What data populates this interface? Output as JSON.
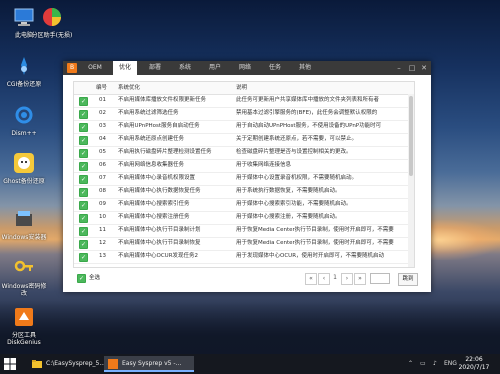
{
  "desktop_icons": [
    {
      "label": "此电脑"
    },
    {
      "label": "分区助手(无损)"
    },
    {
      "label": "CGI备份还原"
    },
    {
      "label": "Dism++"
    },
    {
      "label": "Ghost备份还原"
    },
    {
      "label": "Windows安装器"
    },
    {
      "label": "Windows密码修改"
    },
    {
      "label": "分区工具DiskGenius"
    }
  ],
  "window": {
    "logo": "B",
    "tabs": [
      "OEM",
      "优化",
      "部署",
      "系统",
      "用户",
      "网络",
      "任务",
      "其他"
    ],
    "active_tab": "优化",
    "controls": {
      "min": "–",
      "max": "□",
      "close": "✕"
    },
    "table": {
      "headers": [
        "编号",
        "系统优化",
        "说明"
      ],
      "rows": [
        {
          "id": "01",
          "name": "不启用媒体库播放文件权限更新任务",
          "desc": "此任务可更新用户共享媒体库中播放的文件夹列表和所有者"
        },
        {
          "id": "02",
          "name": "不启用系统过滤筛选任务",
          "desc": "禁用基本过滤引擎服务的(BFE)，此任务会调整默认权限的"
        },
        {
          "id": "03",
          "name": "不启用UPnPHost服务自启动任务",
          "desc": "用于自动启动UPnPHost服务，不使用设备的UPnP功能时可"
        },
        {
          "id": "04",
          "name": "不启用系统还原点创建任务",
          "desc": "关于定期创建系统还原点，若不需要，可以禁止。"
        },
        {
          "id": "05",
          "name": "不启用执行磁盘碎片整理检测设置任务",
          "desc": "检查磁盘碎片整理是否与设置控制相关的更改。"
        },
        {
          "id": "06",
          "name": "不启用网络信息收集器任务",
          "desc": "用于收集网络连接信息"
        },
        {
          "id": "07",
          "name": "不启用媒体中心录音机权限设置",
          "desc": "用于媒体中心设置录音机权限，不需要随机启动。"
        },
        {
          "id": "08",
          "name": "不启用媒体中心执行数据恢复任务",
          "desc": "用于系统执行数据恢复，不需要随机启动。"
        },
        {
          "id": "09",
          "name": "不启用媒体中心搜索索引任务",
          "desc": "用于媒体中心搜索索引功能，不需要随机启动。"
        },
        {
          "id": "10",
          "name": "不启用媒体中心搜索注册任务",
          "desc": "用于媒体中心搜索注册，不需要随机启动。"
        },
        {
          "id": "11",
          "name": "不启用媒体中心执行节目录制计划",
          "desc": "用于恢复Media Center执行节目录制，使用时开启即可，不需要"
        },
        {
          "id": "12",
          "name": "不启用媒体中心执行节目录制恢复",
          "desc": "用于恢复Media Center执行节目录制，使用时开启即可，不需要"
        },
        {
          "id": "13",
          "name": "不启用媒体中心OCUR发现任务2",
          "desc": "用于发现媒体中心OCUR，使用时开启即可，不需要随机启动"
        }
      ]
    },
    "footer": {
      "select_all": "全选",
      "first": "«",
      "prev": "‹",
      "page": "1",
      "next": "›",
      "last": "»",
      "goto": "跳到"
    }
  },
  "taskbar": {
    "items": [
      {
        "label": "C:\\EasySysprep_5..."
      },
      {
        "label": "Easy Sysprep v5 -..."
      }
    ],
    "tray": {
      "lang": "ENG",
      "time": "22:06",
      "date": "2020/7/17"
    }
  }
}
